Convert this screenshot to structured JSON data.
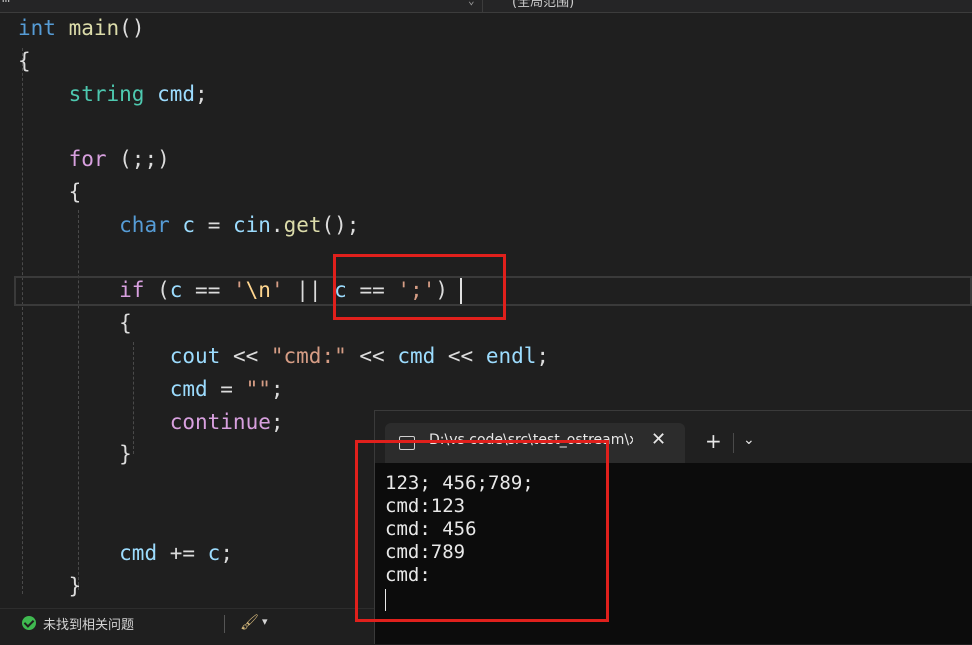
{
  "top_bar": {
    "scope_label": "(全局范围)"
  },
  "code_lines": [
    {
      "tokens": [
        {
          "c": "kw",
          "t": "int"
        },
        {
          "c": "plain",
          "t": " "
        },
        {
          "c": "fn",
          "t": "main"
        },
        {
          "c": "plain",
          "t": "()"
        }
      ]
    },
    {
      "tokens": [
        {
          "c": "plain",
          "t": "{"
        }
      ]
    },
    {
      "tokens": [
        {
          "c": "plain",
          "t": "    "
        },
        {
          "c": "ty",
          "t": "string"
        },
        {
          "c": "plain",
          "t": " "
        },
        {
          "c": "var",
          "t": "cmd"
        },
        {
          "c": "plain",
          "t": ";"
        }
      ]
    },
    {
      "tokens": []
    },
    {
      "tokens": [
        {
          "c": "plain",
          "t": "    "
        },
        {
          "c": "kw2",
          "t": "for"
        },
        {
          "c": "plain",
          "t": " (;;)"
        }
      ]
    },
    {
      "tokens": [
        {
          "c": "plain",
          "t": "    {"
        }
      ]
    },
    {
      "tokens": [
        {
          "c": "plain",
          "t": "        "
        },
        {
          "c": "kw",
          "t": "char"
        },
        {
          "c": "plain",
          "t": " "
        },
        {
          "c": "var",
          "t": "c"
        },
        {
          "c": "plain",
          "t": " = "
        },
        {
          "c": "var",
          "t": "cin"
        },
        {
          "c": "plain",
          "t": "."
        },
        {
          "c": "fn",
          "t": "get"
        },
        {
          "c": "plain",
          "t": "();"
        }
      ]
    },
    {
      "tokens": []
    },
    {
      "tokens": [
        {
          "c": "plain",
          "t": "        "
        },
        {
          "c": "kw2",
          "t": "if"
        },
        {
          "c": "plain",
          "t": " ("
        },
        {
          "c": "var",
          "t": "c"
        },
        {
          "c": "plain",
          "t": " == "
        },
        {
          "c": "str",
          "t": "'"
        },
        {
          "c": "esc",
          "t": "\\n"
        },
        {
          "c": "str",
          "t": "'"
        },
        {
          "c": "plain",
          "t": " || "
        },
        {
          "c": "var",
          "t": "c"
        },
        {
          "c": "plain",
          "t": " == "
        },
        {
          "c": "str",
          "t": "';'"
        },
        {
          "c": "plain",
          "t": ")"
        }
      ]
    },
    {
      "tokens": [
        {
          "c": "plain",
          "t": "        {"
        }
      ]
    },
    {
      "tokens": [
        {
          "c": "plain",
          "t": "            "
        },
        {
          "c": "var",
          "t": "cout"
        },
        {
          "c": "plain",
          "t": " << "
        },
        {
          "c": "str",
          "t": "\"cmd:\""
        },
        {
          "c": "plain",
          "t": " << "
        },
        {
          "c": "var",
          "t": "cmd"
        },
        {
          "c": "plain",
          "t": " << "
        },
        {
          "c": "var",
          "t": "endl"
        },
        {
          "c": "plain",
          "t": ";"
        }
      ]
    },
    {
      "tokens": [
        {
          "c": "plain",
          "t": "            "
        },
        {
          "c": "var",
          "t": "cmd"
        },
        {
          "c": "plain",
          "t": " = "
        },
        {
          "c": "str",
          "t": "\"\""
        },
        {
          "c": "plain",
          "t": ";"
        }
      ]
    },
    {
      "tokens": [
        {
          "c": "plain",
          "t": "            "
        },
        {
          "c": "kw2",
          "t": "continue"
        },
        {
          "c": "plain",
          "t": ";"
        }
      ]
    },
    {
      "tokens": [
        {
          "c": "plain",
          "t": "        }"
        }
      ]
    },
    {
      "tokens": []
    },
    {
      "tokens": []
    },
    {
      "tokens": [
        {
          "c": "plain",
          "t": "        "
        },
        {
          "c": "var",
          "t": "cmd"
        },
        {
          "c": "plain",
          "t": " += "
        },
        {
          "c": "var",
          "t": "c"
        },
        {
          "c": "plain",
          "t": ";"
        }
      ]
    },
    {
      "tokens": [
        {
          "c": "plain",
          "t": "    }"
        }
      ]
    }
  ],
  "terminal": {
    "tab_title": "D:\\vs code\\src\\test_ostream\\x",
    "output_lines": [
      "123; 456;789;",
      "cmd:123",
      "cmd: 456",
      "cmd:789",
      "cmd:"
    ]
  },
  "status_bar": {
    "issues_text": "未找到相关问题"
  },
  "colors": {
    "annotation": "#e0201c",
    "editor_bg": "#1f1f1f",
    "terminal_bg": "#0c0c0c"
  }
}
